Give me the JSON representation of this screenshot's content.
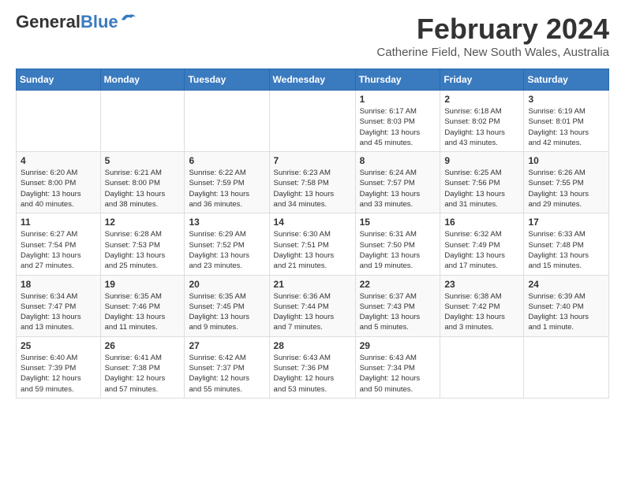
{
  "header": {
    "logo_general": "General",
    "logo_blue": "Blue",
    "month_title": "February 2024",
    "location": "Catherine Field, New South Wales, Australia"
  },
  "days_of_week": [
    "Sunday",
    "Monday",
    "Tuesday",
    "Wednesday",
    "Thursday",
    "Friday",
    "Saturday"
  ],
  "weeks": [
    [
      {
        "day": "",
        "info": ""
      },
      {
        "day": "",
        "info": ""
      },
      {
        "day": "",
        "info": ""
      },
      {
        "day": "",
        "info": ""
      },
      {
        "day": "1",
        "info": "Sunrise: 6:17 AM\nSunset: 8:03 PM\nDaylight: 13 hours\nand 45 minutes."
      },
      {
        "day": "2",
        "info": "Sunrise: 6:18 AM\nSunset: 8:02 PM\nDaylight: 13 hours\nand 43 minutes."
      },
      {
        "day": "3",
        "info": "Sunrise: 6:19 AM\nSunset: 8:01 PM\nDaylight: 13 hours\nand 42 minutes."
      }
    ],
    [
      {
        "day": "4",
        "info": "Sunrise: 6:20 AM\nSunset: 8:00 PM\nDaylight: 13 hours\nand 40 minutes."
      },
      {
        "day": "5",
        "info": "Sunrise: 6:21 AM\nSunset: 8:00 PM\nDaylight: 13 hours\nand 38 minutes."
      },
      {
        "day": "6",
        "info": "Sunrise: 6:22 AM\nSunset: 7:59 PM\nDaylight: 13 hours\nand 36 minutes."
      },
      {
        "day": "7",
        "info": "Sunrise: 6:23 AM\nSunset: 7:58 PM\nDaylight: 13 hours\nand 34 minutes."
      },
      {
        "day": "8",
        "info": "Sunrise: 6:24 AM\nSunset: 7:57 PM\nDaylight: 13 hours\nand 33 minutes."
      },
      {
        "day": "9",
        "info": "Sunrise: 6:25 AM\nSunset: 7:56 PM\nDaylight: 13 hours\nand 31 minutes."
      },
      {
        "day": "10",
        "info": "Sunrise: 6:26 AM\nSunset: 7:55 PM\nDaylight: 13 hours\nand 29 minutes."
      }
    ],
    [
      {
        "day": "11",
        "info": "Sunrise: 6:27 AM\nSunset: 7:54 PM\nDaylight: 13 hours\nand 27 minutes."
      },
      {
        "day": "12",
        "info": "Sunrise: 6:28 AM\nSunset: 7:53 PM\nDaylight: 13 hours\nand 25 minutes."
      },
      {
        "day": "13",
        "info": "Sunrise: 6:29 AM\nSunset: 7:52 PM\nDaylight: 13 hours\nand 23 minutes."
      },
      {
        "day": "14",
        "info": "Sunrise: 6:30 AM\nSunset: 7:51 PM\nDaylight: 13 hours\nand 21 minutes."
      },
      {
        "day": "15",
        "info": "Sunrise: 6:31 AM\nSunset: 7:50 PM\nDaylight: 13 hours\nand 19 minutes."
      },
      {
        "day": "16",
        "info": "Sunrise: 6:32 AM\nSunset: 7:49 PM\nDaylight: 13 hours\nand 17 minutes."
      },
      {
        "day": "17",
        "info": "Sunrise: 6:33 AM\nSunset: 7:48 PM\nDaylight: 13 hours\nand 15 minutes."
      }
    ],
    [
      {
        "day": "18",
        "info": "Sunrise: 6:34 AM\nSunset: 7:47 PM\nDaylight: 13 hours\nand 13 minutes."
      },
      {
        "day": "19",
        "info": "Sunrise: 6:35 AM\nSunset: 7:46 PM\nDaylight: 13 hours\nand 11 minutes."
      },
      {
        "day": "20",
        "info": "Sunrise: 6:35 AM\nSunset: 7:45 PM\nDaylight: 13 hours\nand 9 minutes."
      },
      {
        "day": "21",
        "info": "Sunrise: 6:36 AM\nSunset: 7:44 PM\nDaylight: 13 hours\nand 7 minutes."
      },
      {
        "day": "22",
        "info": "Sunrise: 6:37 AM\nSunset: 7:43 PM\nDaylight: 13 hours\nand 5 minutes."
      },
      {
        "day": "23",
        "info": "Sunrise: 6:38 AM\nSunset: 7:42 PM\nDaylight: 13 hours\nand 3 minutes."
      },
      {
        "day": "24",
        "info": "Sunrise: 6:39 AM\nSunset: 7:40 PM\nDaylight: 13 hours\nand 1 minute."
      }
    ],
    [
      {
        "day": "25",
        "info": "Sunrise: 6:40 AM\nSunset: 7:39 PM\nDaylight: 12 hours\nand 59 minutes."
      },
      {
        "day": "26",
        "info": "Sunrise: 6:41 AM\nSunset: 7:38 PM\nDaylight: 12 hours\nand 57 minutes."
      },
      {
        "day": "27",
        "info": "Sunrise: 6:42 AM\nSunset: 7:37 PM\nDaylight: 12 hours\nand 55 minutes."
      },
      {
        "day": "28",
        "info": "Sunrise: 6:43 AM\nSunset: 7:36 PM\nDaylight: 12 hours\nand 53 minutes."
      },
      {
        "day": "29",
        "info": "Sunrise: 6:43 AM\nSunset: 7:34 PM\nDaylight: 12 hours\nand 50 minutes."
      },
      {
        "day": "",
        "info": ""
      },
      {
        "day": "",
        "info": ""
      }
    ]
  ]
}
